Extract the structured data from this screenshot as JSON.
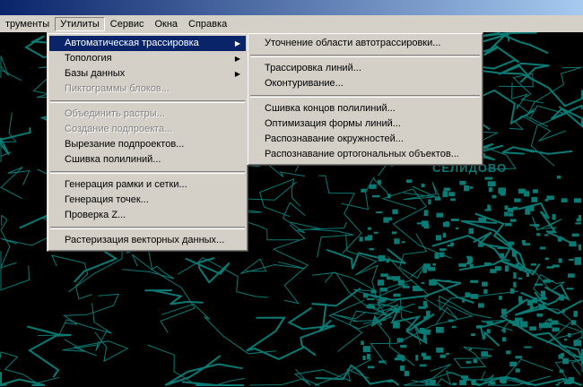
{
  "menubar": {
    "items": [
      "трументы",
      "Утилиты",
      "Сервис",
      "Окна",
      "Справка"
    ],
    "open_index": 1
  },
  "utilities_menu": {
    "groups": [
      [
        {
          "label": "Автоматическая трассировка",
          "submenu": true,
          "selected": true
        },
        {
          "label": "Топология",
          "submenu": true
        },
        {
          "label": "Базы данных",
          "submenu": true
        },
        {
          "label": "Пиктограммы блоков...",
          "disabled": true
        }
      ],
      [
        {
          "label": "Объединить растры...",
          "disabled": true
        },
        {
          "label": "Создание подпроекта...",
          "disabled": true
        },
        {
          "label": "Вырезание подпроектов..."
        },
        {
          "label": "Сшивка полилиний..."
        }
      ],
      [
        {
          "label": "Генерация рамки и сетки..."
        },
        {
          "label": "Генерация точек..."
        },
        {
          "label": "Проверка Z..."
        }
      ],
      [
        {
          "label": "Растеризация векторных данных..."
        }
      ]
    ]
  },
  "autotrace_submenu": {
    "groups": [
      [
        {
          "label": "Уточнение области автотрассировки..."
        }
      ],
      [
        {
          "label": "Трассировка линий..."
        },
        {
          "label": "Оконтуривание..."
        }
      ],
      [
        {
          "label": "Сшивка концов полилиний..."
        },
        {
          "label": "Оптимизация формы линий..."
        },
        {
          "label": "Распознавание окружностей..."
        },
        {
          "label": "Распознавание ортогональных объектов..."
        }
      ]
    ]
  },
  "map": {
    "place_label": "СЕЛИДОВО",
    "line_color": "#0a7a74",
    "background": "#000000"
  }
}
